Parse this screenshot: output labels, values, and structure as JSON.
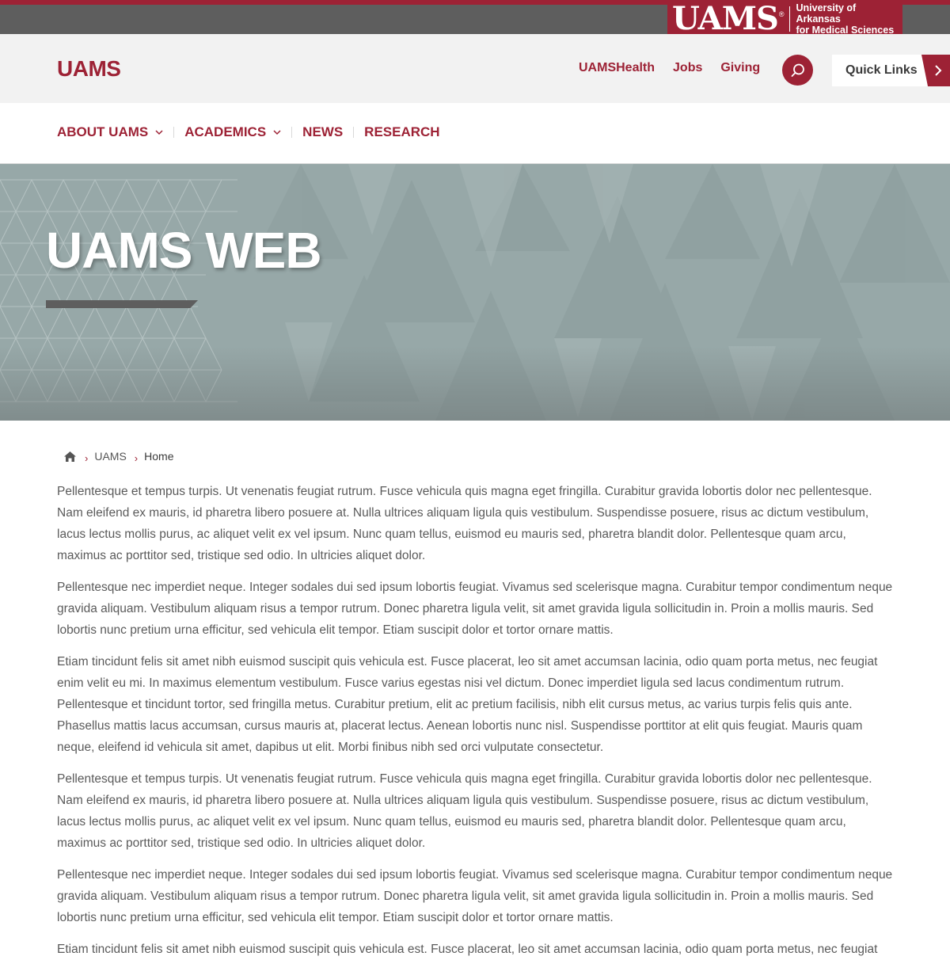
{
  "colors": {
    "brand": "#9d2235",
    "utility_bar": "#5e5e5e",
    "header_bg": "#f2f2f2",
    "hero_bg": "#97a8a8"
  },
  "brand": {
    "logo_text": "UAMS",
    "logo_registered": "®",
    "name_line1": "University of Arkansas",
    "name_line2": "for Medical Sciences"
  },
  "header": {
    "site_title": "UAMS",
    "util_links": [
      "UAMSHealth",
      "Jobs",
      "Giving"
    ],
    "search_icon": "search-icon",
    "quick_links_label": "Quick Links",
    "quick_links_icon": "chevron-right-icon"
  },
  "nav": {
    "items": [
      {
        "label": "ABOUT UAMS",
        "has_dropdown": true
      },
      {
        "label": "ACADEMICS",
        "has_dropdown": true
      },
      {
        "label": "NEWS",
        "has_dropdown": false
      },
      {
        "label": "RESEARCH",
        "has_dropdown": false
      }
    ]
  },
  "hero": {
    "title": "UAMS WEB"
  },
  "breadcrumb": {
    "home_icon": "home-icon",
    "items": [
      "UAMS"
    ],
    "current": "Home"
  },
  "content": {
    "paragraphs": [
      "Pellentesque et tempus turpis. Ut venenatis feugiat rutrum. Fusce vehicula quis magna eget fringilla. Curabitur gravida lobortis dolor nec pellentesque. Nam eleifend ex mauris, id pharetra libero posuere at. Nulla ultrices aliquam ligula quis vestibulum. Suspendisse posuere, risus ac dictum vestibulum, lacus lectus mollis purus, ac aliquet velit ex vel ipsum. Nunc quam tellus, euismod eu mauris sed, pharetra blandit dolor. Pellentesque quam arcu, maximus ac porttitor sed, tristique sed odio. In ultricies aliquet dolor.",
      "Pellentesque nec imperdiet neque. Integer sodales dui sed ipsum lobortis feugiat. Vivamus sed scelerisque magna. Curabitur tempor condimentum neque gravida aliquam. Vestibulum aliquam risus a tempor rutrum. Donec pharetra ligula velit, sit amet gravida ligula sollicitudin in. Proin a mollis mauris. Sed lobortis nunc pretium urna efficitur, sed vehicula elit tempor. Etiam suscipit dolor et tortor ornare mattis.",
      "Etiam tincidunt felis sit amet nibh euismod suscipit quis vehicula est. Fusce placerat, leo sit amet accumsan lacinia, odio quam porta metus, nec feugiat enim velit eu mi. In maximus elementum vestibulum. Fusce varius egestas nisi vel dictum. Donec imperdiet ligula sed lacus condimentum rutrum. Pellentesque et tincidunt tortor, sed fringilla metus. Curabitur pretium, elit ac pretium facilisis, nibh elit cursus metus, ac varius turpis felis quis ante. Phasellus mattis lacus accumsan, cursus mauris at, placerat lectus. Aenean lobortis nunc nisl. Suspendisse porttitor at elit quis feugiat. Mauris quam neque, eleifend id vehicula sit amet, dapibus ut elit. Morbi finibus nibh sed orci vulputate consectetur.",
      "Pellentesque et tempus turpis. Ut venenatis feugiat rutrum. Fusce vehicula quis magna eget fringilla. Curabitur gravida lobortis dolor nec pellentesque. Nam eleifend ex mauris, id pharetra libero posuere at. Nulla ultrices aliquam ligula quis vestibulum. Suspendisse posuere, risus ac dictum vestibulum, lacus lectus mollis purus, ac aliquet velit ex vel ipsum. Nunc quam tellus, euismod eu mauris sed, pharetra blandit dolor. Pellentesque quam arcu, maximus ac porttitor sed, tristique sed odio. In ultricies aliquet dolor.",
      "Pellentesque nec imperdiet neque. Integer sodales dui sed ipsum lobortis feugiat. Vivamus sed scelerisque magna. Curabitur tempor condimentum neque gravida aliquam. Vestibulum aliquam risus a tempor rutrum. Donec pharetra ligula velit, sit amet gravida ligula sollicitudin in. Proin a mollis mauris. Sed lobortis nunc pretium urna efficitur, sed vehicula elit tempor. Etiam suscipit dolor et tortor ornare mattis.",
      "Etiam tincidunt felis sit amet nibh euismod suscipit quis vehicula est. Fusce placerat, leo sit amet accumsan lacinia, odio quam porta metus, nec feugiat enim"
    ]
  }
}
